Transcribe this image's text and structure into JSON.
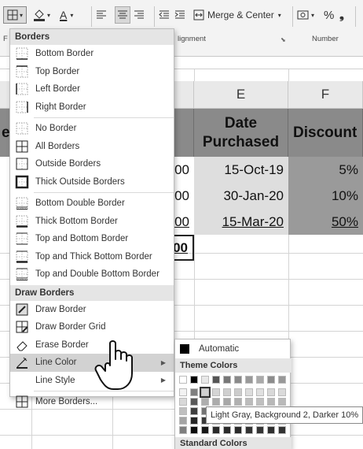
{
  "ribbon": {
    "font_color_letter": "A",
    "merge_label": "Merge & Center",
    "percent_symbol": "%",
    "comma_symbol": "❟",
    "groups": {
      "font_label_fragment": "F",
      "alignment_label_fragment": "lignment",
      "number_label": "Number"
    }
  },
  "sheet": {
    "col_e": "E",
    "col_f": "F",
    "header_e_line1": "Date",
    "header_e_line2": "Purchased",
    "header_f": "Discount",
    "left_fragment_header": "e",
    "rows": [
      {
        "left": "00",
        "date": "15-Oct-19",
        "discount": "5%",
        "underline": false
      },
      {
        "left": "00",
        "date": "30-Jan-20",
        "discount": "10%",
        "underline": false
      },
      {
        "left": "00",
        "date": "15-Mar-20",
        "discount": "50%",
        "underline": true
      }
    ],
    "row4_left": "00"
  },
  "borders_menu": {
    "section_borders": "Borders",
    "items": [
      {
        "label": "Bottom Border",
        "icon": "border-bottom-icon"
      },
      {
        "label": "Top Border",
        "icon": "border-top-icon"
      },
      {
        "label": "Left Border",
        "icon": "border-left-icon"
      },
      {
        "label": "Right Border",
        "icon": "border-right-icon"
      },
      {
        "label": "No Border",
        "icon": "border-none-icon"
      },
      {
        "label": "All Borders",
        "icon": "border-all-icon"
      },
      {
        "label": "Outside Borders",
        "icon": "border-outside-icon"
      },
      {
        "label": "Thick Outside Borders",
        "icon": "border-thick-outside-icon"
      },
      {
        "label": "Bottom Double Border",
        "icon": "border-bottom-double-icon"
      },
      {
        "label": "Thick Bottom Border",
        "icon": "border-thick-bottom-icon"
      },
      {
        "label": "Top and Bottom Border",
        "icon": "border-top-bottom-icon"
      },
      {
        "label": "Top and Thick Bottom Border",
        "icon": "border-top-thick-bottom-icon"
      },
      {
        "label": "Top and Double Bottom Border",
        "icon": "border-top-double-bottom-icon"
      }
    ],
    "section_draw": "Draw Borders",
    "draw_items": [
      {
        "label": "Draw Border",
        "icon": "draw-border-icon"
      },
      {
        "label": "Draw Border Grid",
        "icon": "draw-border-grid-icon"
      },
      {
        "label": "Erase Border",
        "icon": "eraser-icon"
      },
      {
        "label": "Line Color",
        "icon": "line-color-icon"
      },
      {
        "label": "Line Style",
        "icon": ""
      },
      {
        "label": "More Borders...",
        "icon": "more-borders-icon"
      }
    ]
  },
  "line_color_menu": {
    "automatic_label": "Automatic",
    "theme_colors_label": "Theme Colors",
    "standard_colors_label": "Standard Colors"
  },
  "tooltip": {
    "text": "Light Gray, Background 2, Darker 10%"
  },
  "colors": {
    "header_fill": "#8a8a8a",
    "date_fill": "#dedede",
    "discount_fill": "#9a9a9a",
    "menu_highlight": "#d2d2d2"
  }
}
